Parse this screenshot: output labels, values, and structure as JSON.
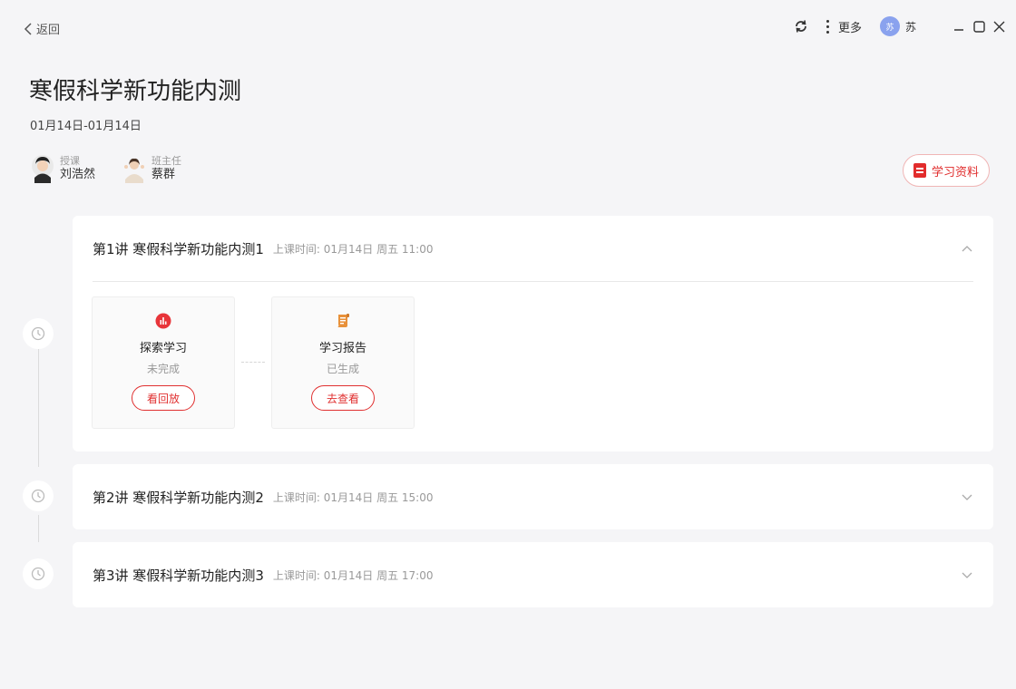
{
  "header": {
    "back_label": "返回",
    "more_label": "更多",
    "user_avatar_text": "苏",
    "user_name": "苏"
  },
  "course": {
    "title": "寒假科学新功能内测",
    "date_range": "01月14日-01月14日",
    "teachers": [
      {
        "role": "授课",
        "name": "刘浩然"
      },
      {
        "role": "班主任",
        "name": "蔡群"
      }
    ],
    "materials_label": "学习资料"
  },
  "lessons": [
    {
      "title": "第1讲 寒假科学新功能内测1",
      "time": "上课时间: 01月14日 周五 11:00",
      "expanded": true,
      "cards": [
        {
          "icon": "explore-chart-icon",
          "title": "探索学习",
          "status": "未完成",
          "button": "看回放"
        },
        {
          "icon": "report-scroll-icon",
          "title": "学习报告",
          "status": "已生成",
          "button": "去查看"
        }
      ]
    },
    {
      "title": "第2讲 寒假科学新功能内测2",
      "time": "上课时间: 01月14日 周五 15:00",
      "expanded": false
    },
    {
      "title": "第3讲 寒假科学新功能内测3",
      "time": "上课时间: 01月14日 周五 17:00",
      "expanded": false
    }
  ],
  "colors": {
    "accent_red": "#e03030",
    "avatar_blue": "#8aa2ee",
    "page_bg": "#f5f5f7",
    "report_orange": "#e8913a"
  }
}
